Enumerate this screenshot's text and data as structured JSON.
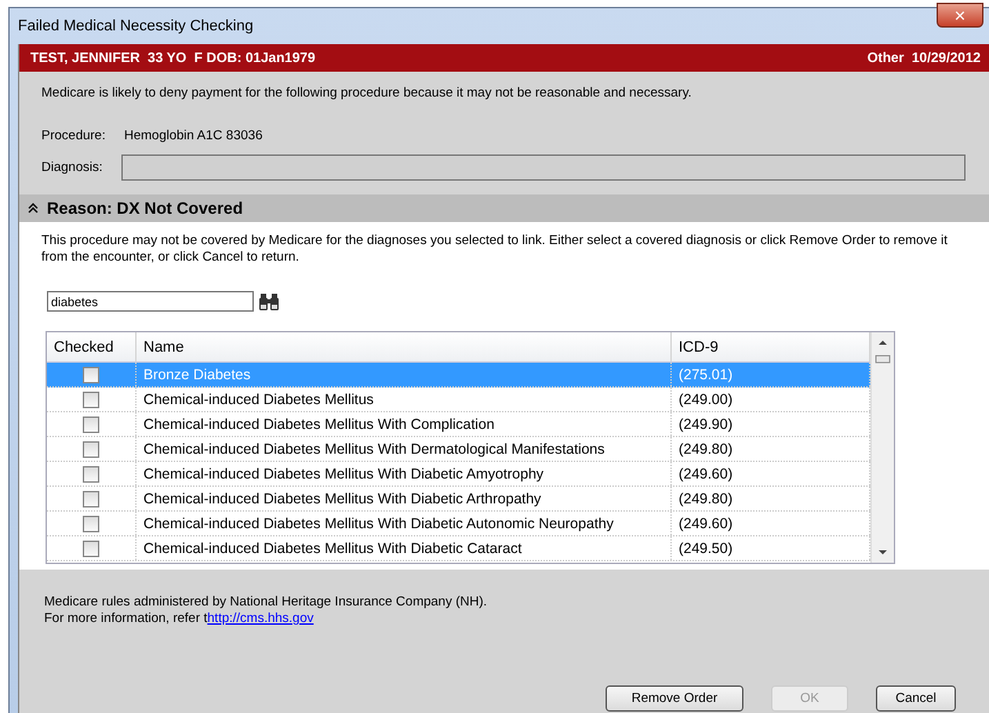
{
  "window": {
    "title": "Failed Medical Necessity Checking",
    "close": "×"
  },
  "patient_bar": {
    "patient": "TEST, JENNIFER  33 YO  F DOB: 01Jan1979",
    "context": "Other  10/29/2012"
  },
  "message": "Medicare is likely to deny payment for the following procedure because it may not be reasonable and necessary.",
  "procedure": {
    "label": "Procedure:",
    "value": "Hemoglobin A1C 83036"
  },
  "diagnosis": {
    "label": "Diagnosis:"
  },
  "reason": {
    "title": "Reason: DX Not Covered",
    "expanded": true,
    "text": "This procedure may not be covered by Medicare for the diagnoses you selected to link. Either select a covered diagnosis or click Remove Order to remove it from the encounter, or click Cancel to return."
  },
  "search": {
    "value": "diabetes"
  },
  "table": {
    "columns": [
      "Checked",
      "Name",
      "ICD-9"
    ],
    "rows": [
      {
        "checked": false,
        "selected": true,
        "name": "Bronze Diabetes",
        "code": "(275.01)"
      },
      {
        "checked": false,
        "selected": false,
        "name": "Chemical-induced Diabetes Mellitus",
        "code": "(249.00)"
      },
      {
        "checked": false,
        "selected": false,
        "name": "Chemical-induced Diabetes Mellitus With Complication",
        "code": "(249.90)"
      },
      {
        "checked": false,
        "selected": false,
        "name": "Chemical-induced Diabetes Mellitus With Dermatological Manifestations",
        "code": "(249.80)"
      },
      {
        "checked": false,
        "selected": false,
        "name": "Chemical-induced Diabetes Mellitus With Diabetic Amyotrophy",
        "code": "(249.60)"
      },
      {
        "checked": false,
        "selected": false,
        "name": "Chemical-induced Diabetes Mellitus With Diabetic Arthropathy",
        "code": "(249.80)"
      },
      {
        "checked": false,
        "selected": false,
        "name": "Chemical-induced Diabetes Mellitus With Diabetic Autonomic Neuropathy",
        "code": "(249.60)"
      },
      {
        "checked": false,
        "selected": false,
        "name": "Chemical-induced Diabetes Mellitus With Diabetic Cataract",
        "code": "(249.50)"
      }
    ]
  },
  "footer": {
    "line1": "Medicare rules administered by National Heritage Insurance Company (NH).",
    "line2": "For more information, refer t",
    "link": "http://cms.hhs.gov"
  },
  "buttons": [
    {
      "label": "Remove Order",
      "disabled": false
    },
    {
      "label": "OK",
      "disabled": true
    },
    {
      "label": "Cancel",
      "disabled": false
    }
  ]
}
